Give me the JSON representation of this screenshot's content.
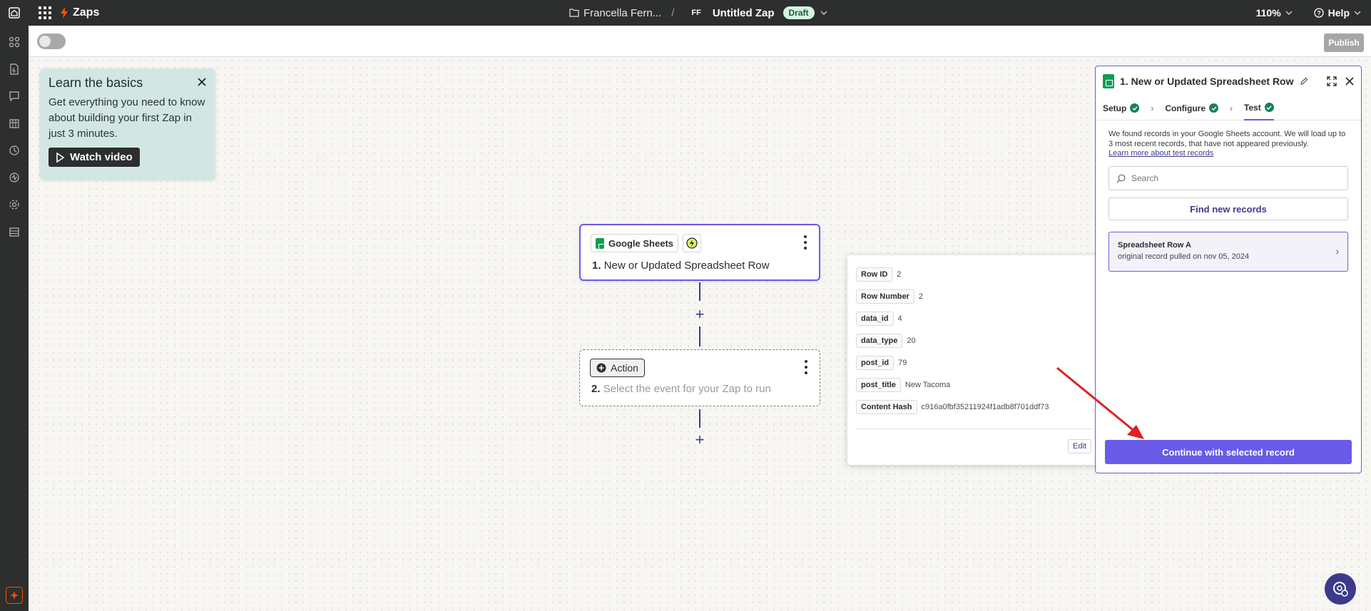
{
  "topbar": {
    "brand": "Zaps",
    "folder": "Francella Fern...",
    "separator": "/",
    "user_initials": "FF",
    "zap_title": "Untitled Zap",
    "status_badge": "Draft",
    "zoom": "110%",
    "help": "Help"
  },
  "subbar": {
    "publish": "Publish"
  },
  "learn": {
    "title": "Learn the basics",
    "body": "Get everything you need to know about building your first Zap in just 3 minutes.",
    "cta": "Watch video"
  },
  "step1": {
    "app": "Google Sheets",
    "number": "1.",
    "title": "New or Updated Spreadsheet Row"
  },
  "step2": {
    "chip": "Action",
    "number": "2.",
    "title": "Select the event for your Zap to run"
  },
  "record": {
    "fields": [
      {
        "key": "Row ID",
        "value": "2"
      },
      {
        "key": "Row Number",
        "value": "2"
      },
      {
        "key": "data_id",
        "value": "4"
      },
      {
        "key": "data_type",
        "value": "20"
      },
      {
        "key": "post_id",
        "value": "79"
      },
      {
        "key": "post_title",
        "value": "New Tacoma"
      },
      {
        "key": "Content Hash",
        "value": "c916a0fbf35211924f1adb8f701ddf73"
      }
    ],
    "edit": "Edit"
  },
  "panel": {
    "title": "1. New or Updated Spreadsheet Row",
    "tabs": [
      "Setup",
      "Configure",
      "Test"
    ],
    "found_text": "We found records in your Google Sheets account. We will load up to 3 most recent records, that have not appeared previously.",
    "learn_link": "Learn more about test records",
    "search_placeholder": "Search",
    "find_button": "Find new records",
    "record_title": "Spreadsheet Row A",
    "record_sub": "original record pulled on nov 05, 2024",
    "continue": "Continue with selected record"
  },
  "colors": {
    "accent": "#695be8",
    "topbar": "#2d2e2e",
    "brand_orange": "#ff4f00",
    "arrow": "#e02020",
    "success": "#18805b"
  }
}
